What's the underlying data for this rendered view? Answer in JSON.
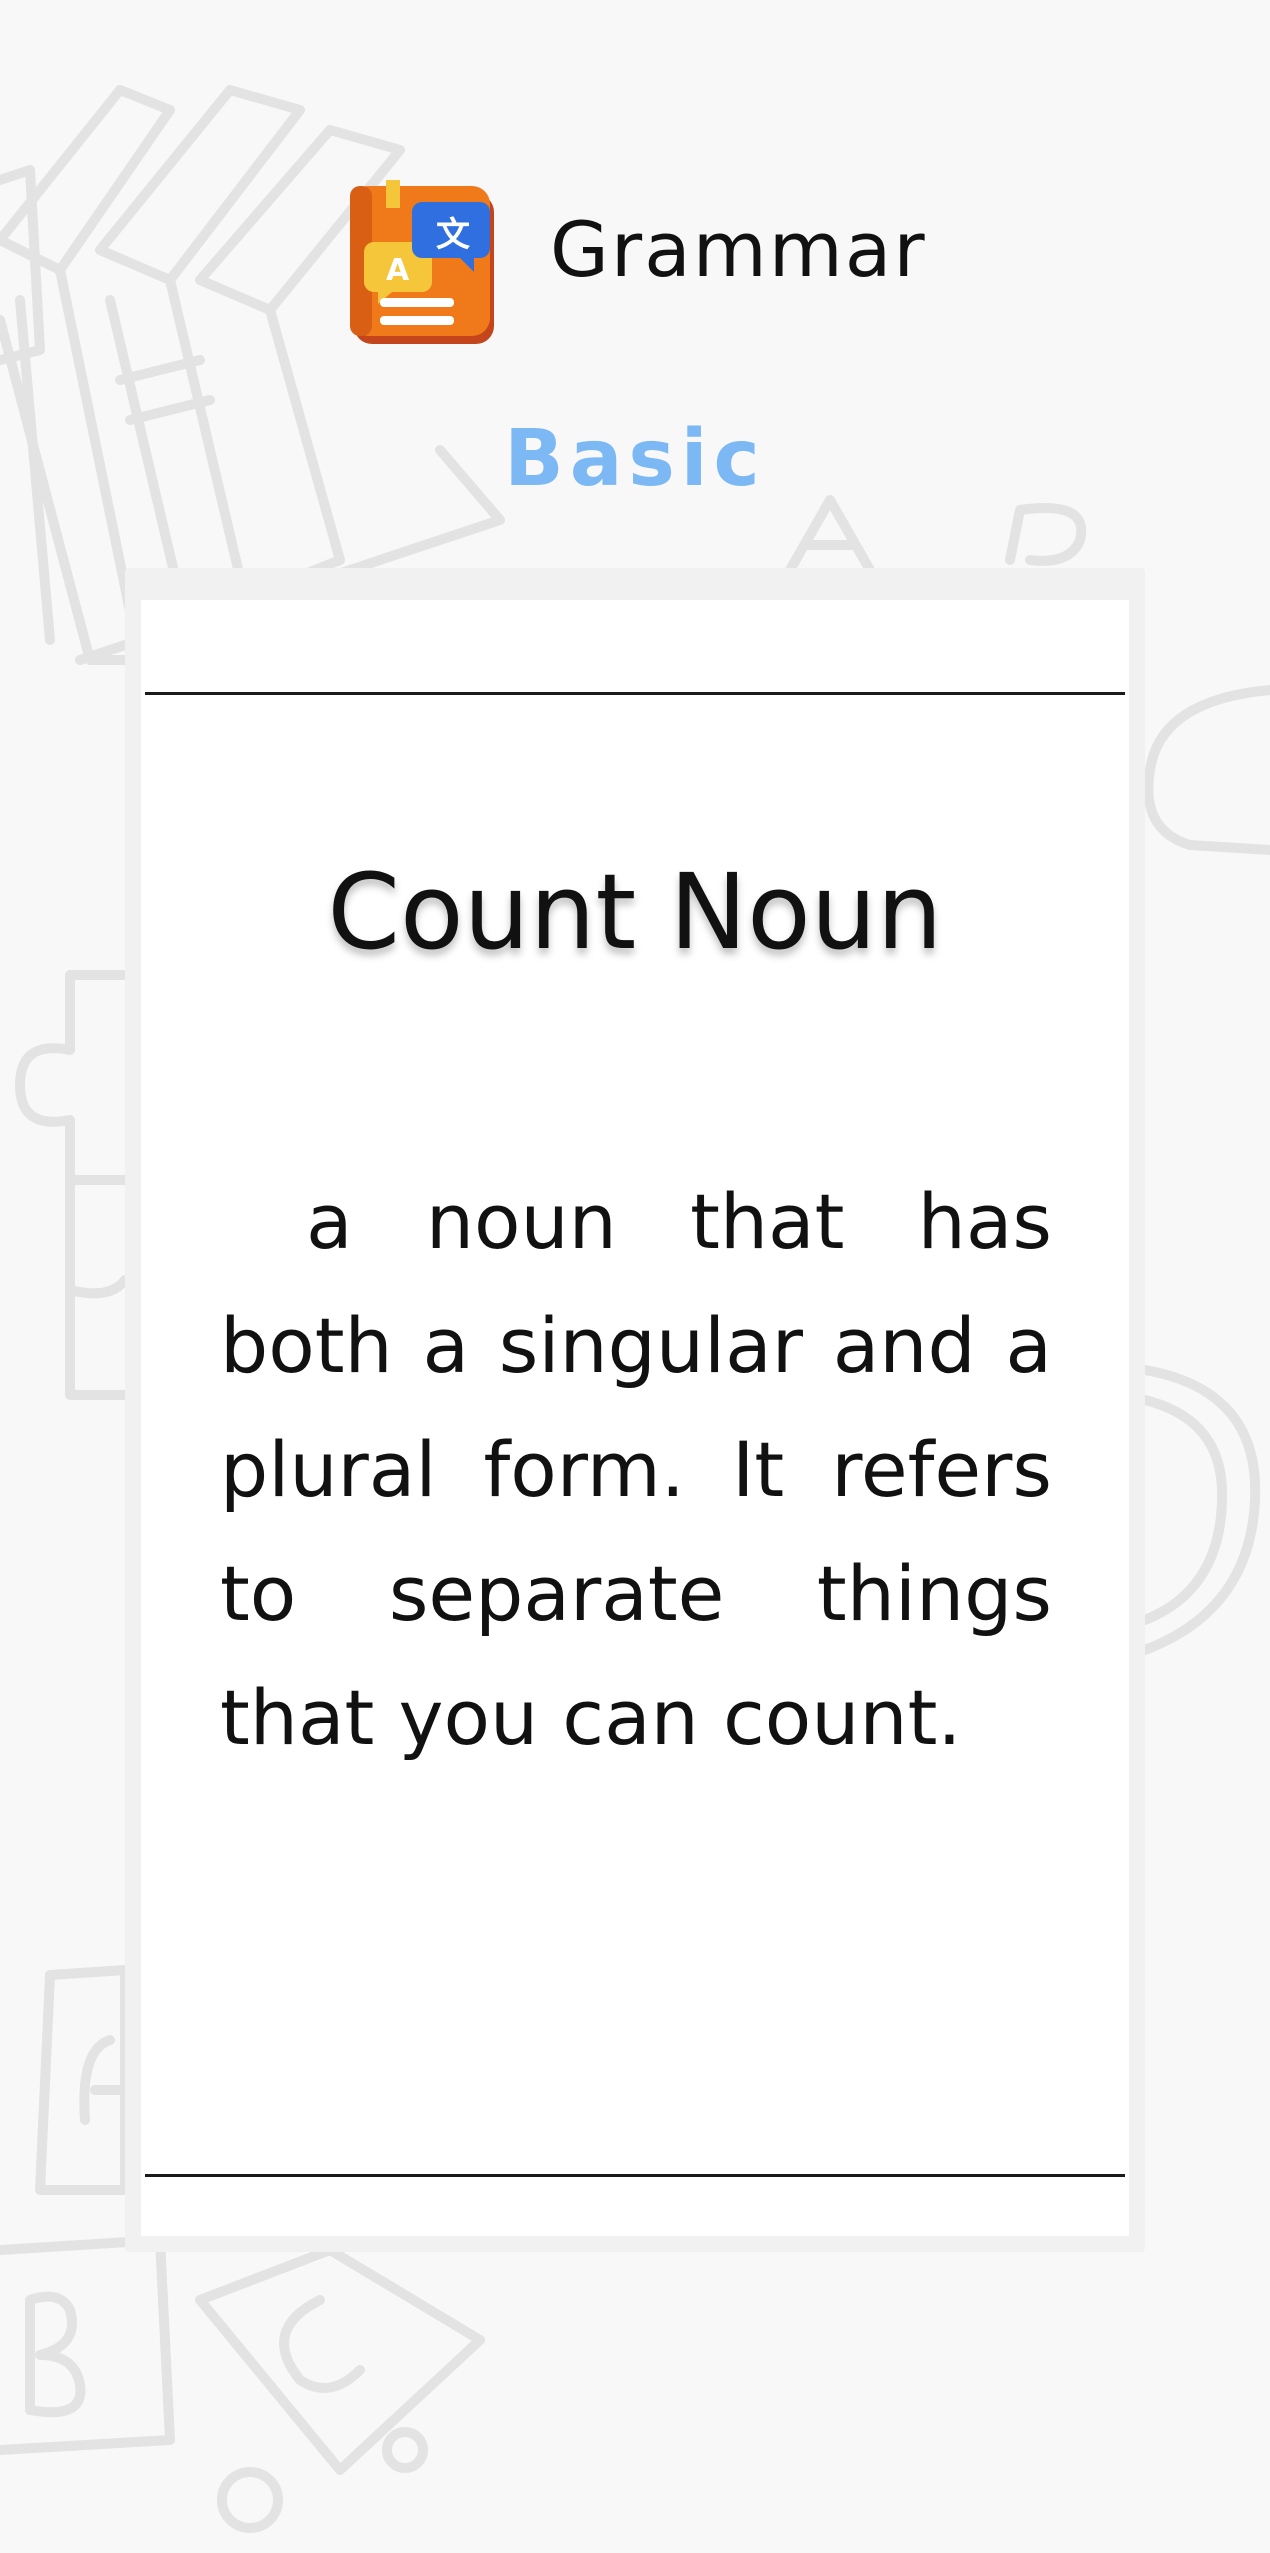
{
  "header": {
    "app_title": "Grammar",
    "app_icon": "grammar-book-translate-icon",
    "level": "Basic"
  },
  "card": {
    "term": "Count Noun",
    "definition": "a noun that has both a singular and a plural form. It refers to separate things that you can count."
  },
  "colors": {
    "background": "#f8f8f8",
    "level_accent": "#7cb9f4",
    "icon_orange": "#f07a1a",
    "icon_blue": "#2f6fe0",
    "icon_yellow": "#f5c53a"
  }
}
